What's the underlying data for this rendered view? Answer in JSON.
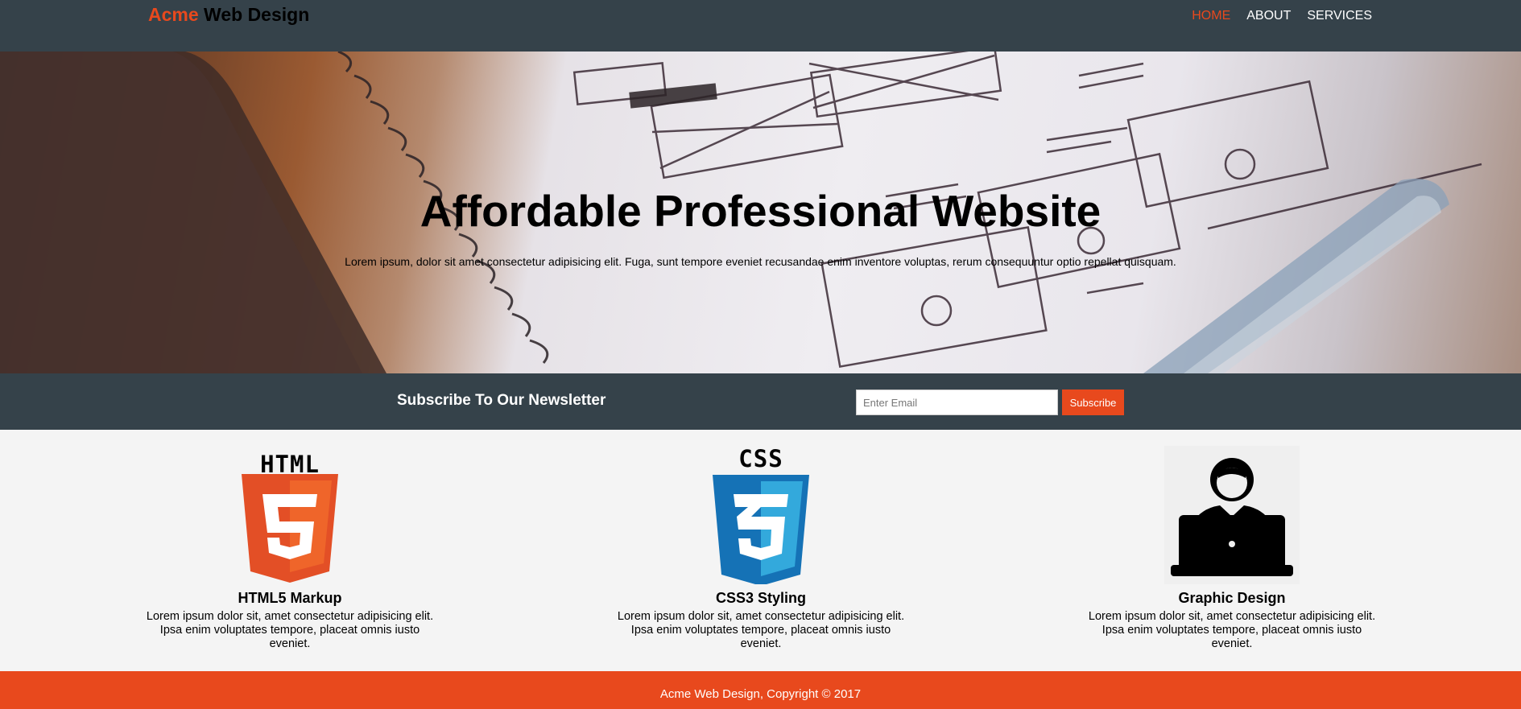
{
  "header": {
    "brand_highlight": "Acme",
    "brand_rest": " Web Design",
    "nav": [
      {
        "label": "HOME",
        "active": true
      },
      {
        "label": "ABOUT",
        "active": false
      },
      {
        "label": "SERVICES",
        "active": false
      }
    ]
  },
  "showcase": {
    "title": "Affordable Professional Website",
    "text": "Lorem ipsum, dolor sit amet consectetur adipisicing elit. Fuga, sunt tempore eveniet recusandae enim inventore voluptas, rerum consequuntur optio repellat quisquam."
  },
  "newsletter": {
    "heading": "Subscribe To Our Newsletter",
    "email_placeholder": "Enter Email",
    "button_label": "Subscribe"
  },
  "boxes": [
    {
      "icon": "html5-logo-icon",
      "logo_text": "HTML",
      "title": "HTML5 Markup",
      "text": "Lorem ipsum dolor sit, amet consectetur adipisicing elit. Ipsa enim voluptates tempore, placeat omnis iusto eveniet."
    },
    {
      "icon": "css3-logo-icon",
      "logo_text": "CSS",
      "title": "CSS3 Styling",
      "text": "Lorem ipsum dolor sit, amet consectetur adipisicing elit. Ipsa enim voluptates tempore, placeat omnis iusto eveniet."
    },
    {
      "icon": "designer-laptop-icon",
      "title": "Graphic Design",
      "text": "Lorem ipsum dolor sit, amet consectetur adipisicing elit. Ipsa enim voluptates tempore, placeat omnis iusto eveniet."
    }
  ],
  "footer": {
    "text": "Acme Web Design, Copyright © 2017"
  },
  "colors": {
    "accent": "#e8491d",
    "header_bg": "#35424a",
    "boxes_bg": "#f4f4f4"
  }
}
